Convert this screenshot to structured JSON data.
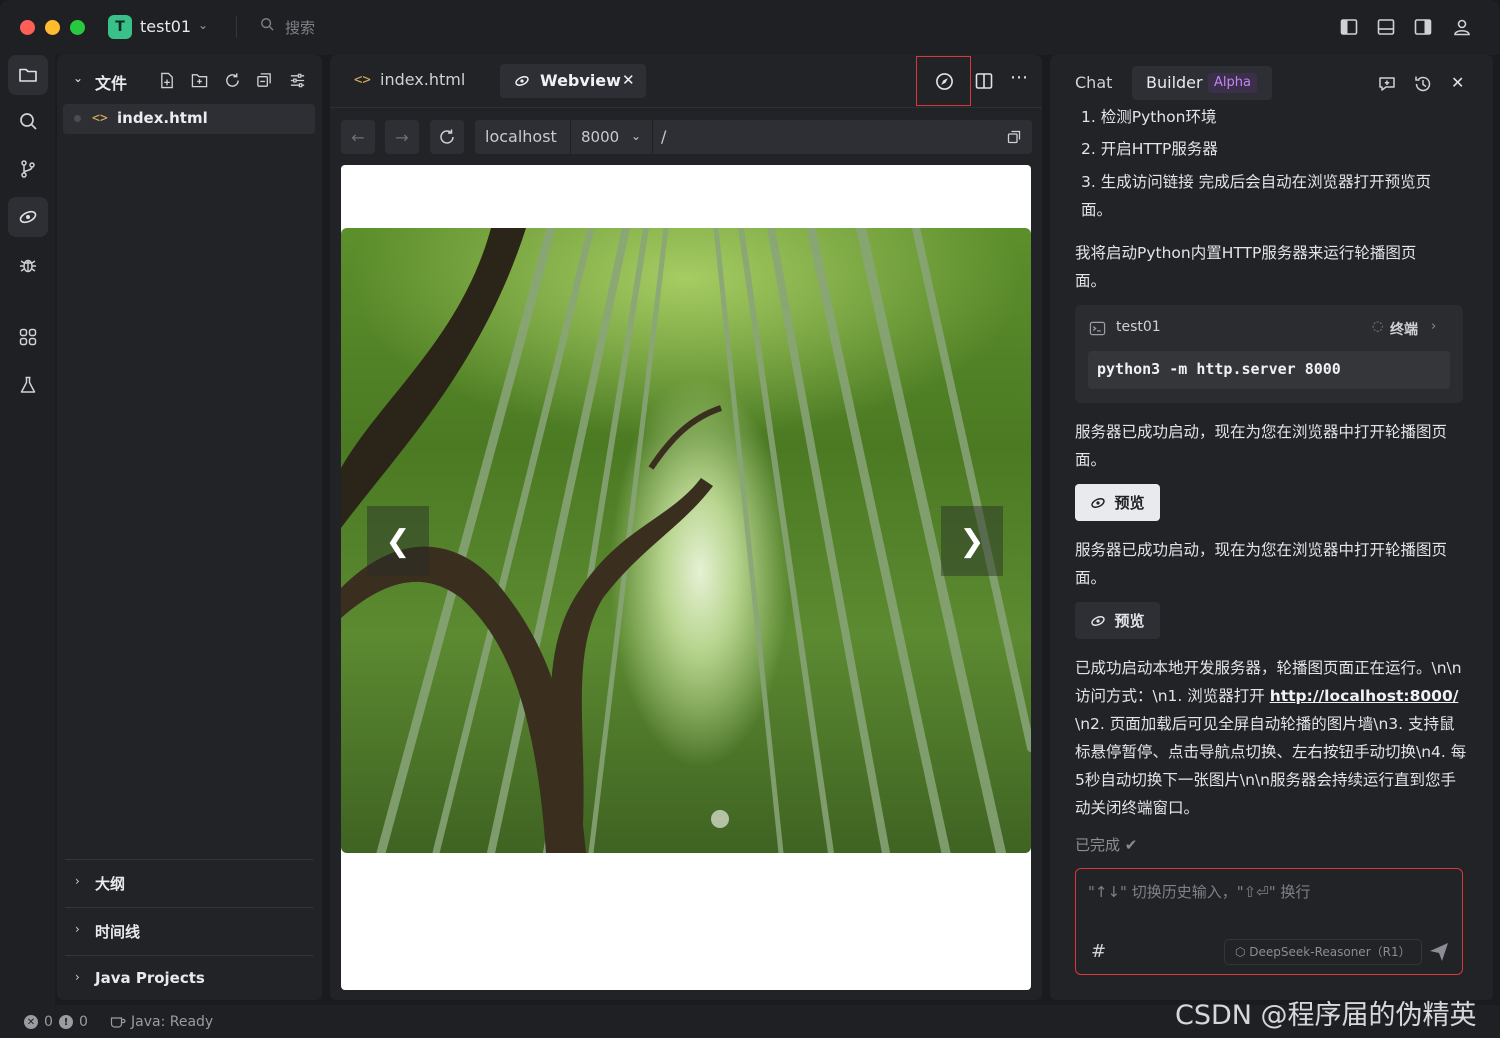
{
  "titlebar": {
    "project_initial": "T",
    "project_name": "test01",
    "search_label": "搜索"
  },
  "explorer": {
    "header_title": "文件",
    "files": [
      {
        "name": "index.html"
      }
    ],
    "sections": [
      {
        "label": "大纲"
      },
      {
        "label": "时间线"
      },
      {
        "label": "Java Projects"
      }
    ]
  },
  "editor": {
    "tabs": [
      {
        "label": "index.html",
        "icon": "code-icon"
      },
      {
        "label": "Webview",
        "icon": "preview-icon",
        "close": "✕"
      }
    ],
    "url": {
      "host": "localhost",
      "port": "8000",
      "path": "/"
    },
    "carousel": {
      "prev": "❮",
      "next": "❯"
    }
  },
  "chat": {
    "tab_chat": "Chat",
    "tab_builder": "Builder",
    "alpha_badge": "Alpha",
    "steps": [
      "1. 检测Python环境",
      "2. 开启HTTP服务器",
      "3. 生成访问链接 完成后会自动在浏览器打开预览页面。"
    ],
    "intro": "我将启动Python内置HTTP服务器来运行轮播图页面。",
    "terminal": {
      "name": "test01",
      "status": "终端",
      "command": "python3 -m http.server 8000"
    },
    "msg1": "服务器已成功启动，现在为您在浏览器中打开轮播图页面。",
    "preview_label": "预览",
    "msg2": "服务器已成功启动，现在为您在浏览器中打开轮播图页面。",
    "final_before": "已成功启动本地开发服务器，轮播图页面正在运行。\\n\\n访问方式：\\n1. 浏览器打开 ",
    "final_link": "http://localhost:8000/",
    "final_after": "\\n2. 页面加载后可见全屏自动轮播的图片墙\\n3. 支持鼠标悬停暂停、点击导航点切换、左右按钮手动切换\\n4. 每5秒自动切换下一张图片\\n\\n服务器会持续运行直到您手动关闭终端窗口。",
    "done_label": "已完成 ✔",
    "input_placeholder": "\"↑↓\" 切换历史输入，\"⇧⏎\" 换行",
    "input_hash": "#",
    "model": "⬡ DeepSeek-Reasoner（R1）"
  },
  "statusbar": {
    "errors": "0",
    "warnings": "0",
    "java_status": "Java: Ready"
  },
  "watermark": "CSDN @程序届的伪精英",
  "colors": {
    "accent_red": "#d9363e",
    "badge_green": "#3ac18a",
    "alpha_purple": "#c286f5"
  }
}
